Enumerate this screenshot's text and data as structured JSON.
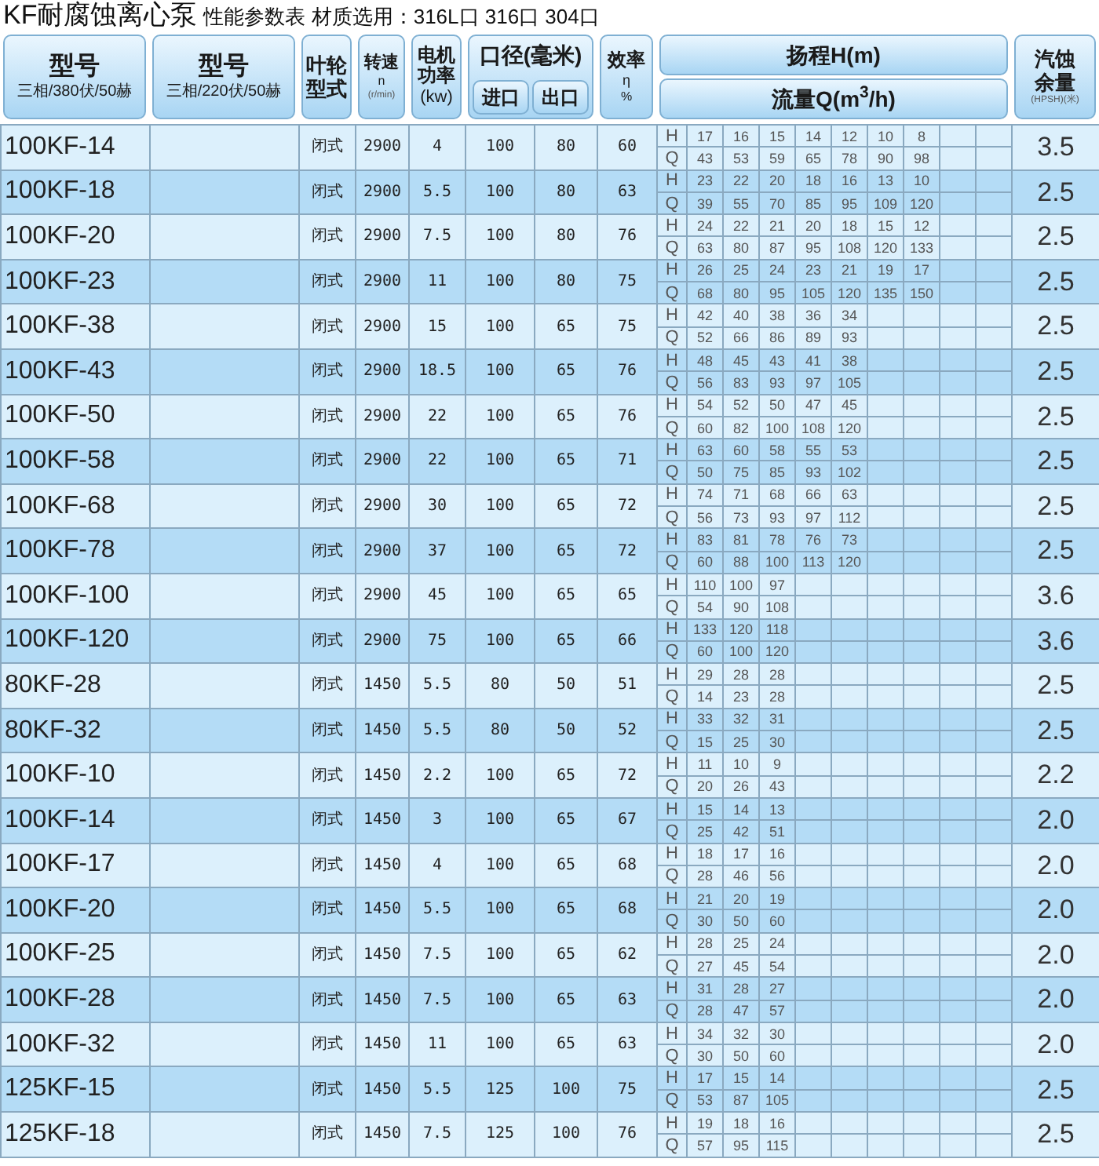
{
  "title": {
    "main": "KF耐腐蚀离心泵",
    "sub": "性能参数表 材质选用：316L口 316口 304口"
  },
  "header": {
    "model_380": {
      "label": "型号",
      "note": "三相/380伏/50赫"
    },
    "model_220": {
      "label": "型号",
      "note": "三相/220伏/50赫"
    },
    "impeller": "叶轮型式",
    "speed": {
      "label": "转速",
      "symbol": "n",
      "unit": "(r/min)"
    },
    "power": {
      "label": "电机功率",
      "unit": "(kw)"
    },
    "bore": {
      "label": "口径(毫米)",
      "inlet": "进口",
      "outlet": "出口"
    },
    "efficiency": {
      "label": "效率",
      "symbol": "η",
      "unit": "%"
    },
    "head": "扬程H(m)",
    "flow": "流量Q(m$^{3}$/h)",
    "npsh": {
      "label": "汽蚀余量",
      "unit": "(HPSH)(米)"
    }
  },
  "rows": [
    {
      "model": "100KF-14",
      "impeller": "闭式",
      "speed": "2900",
      "power": "4",
      "inlet": "100",
      "outlet": "80",
      "efficiency": "60",
      "h_label": "H",
      "h": [
        "17",
        "16",
        "15",
        "14",
        "12",
        "10",
        "8"
      ],
      "q_label": "Q",
      "q": [
        "43",
        "53",
        "59",
        "65",
        "78",
        "90",
        "98"
      ],
      "npsh": "3.5"
    },
    {
      "model": "100KF-18",
      "impeller": "闭式",
      "speed": "2900",
      "power": "5.5",
      "inlet": "100",
      "outlet": "80",
      "efficiency": "63",
      "h_label": "H",
      "h": [
        "23",
        "22",
        "20",
        "18",
        "16",
        "13",
        "10"
      ],
      "q_label": "Q",
      "q": [
        "39",
        "55",
        "70",
        "85",
        "95",
        "109",
        "120"
      ],
      "npsh": "2.5"
    },
    {
      "model": "100KF-20",
      "impeller": "闭式",
      "speed": "2900",
      "power": "7.5",
      "inlet": "100",
      "outlet": "80",
      "efficiency": "76",
      "h_label": "H",
      "h": [
        "24",
        "22",
        "21",
        "20",
        "18",
        "15",
        "12"
      ],
      "q_label": "Q",
      "q": [
        "63",
        "80",
        "87",
        "95",
        "108",
        "120",
        "133"
      ],
      "npsh": "2.5"
    },
    {
      "model": "100KF-23",
      "impeller": "闭式",
      "speed": "2900",
      "power": "11",
      "inlet": "100",
      "outlet": "80",
      "efficiency": "75",
      "h_label": "H",
      "h": [
        "26",
        "25",
        "24",
        "23",
        "21",
        "19",
        "17"
      ],
      "q_label": "Q",
      "q": [
        "68",
        "80",
        "95",
        "105",
        "120",
        "135",
        "150"
      ],
      "npsh": "2.5"
    },
    {
      "model": "100KF-38",
      "impeller": "闭式",
      "speed": "2900",
      "power": "15",
      "inlet": "100",
      "outlet": "65",
      "efficiency": "75",
      "h_label": "H",
      "h": [
        "42",
        "40",
        "38",
        "36",
        "34"
      ],
      "q_label": "Q",
      "q": [
        "52",
        "66",
        "86",
        "89",
        "93"
      ],
      "npsh": "2.5"
    },
    {
      "model": "100KF-43",
      "impeller": "闭式",
      "speed": "2900",
      "power": "18.5",
      "inlet": "100",
      "outlet": "65",
      "efficiency": "76",
      "h_label": "H",
      "h": [
        "48",
        "45",
        "43",
        "41",
        "38"
      ],
      "q_label": "Q",
      "q": [
        "56",
        "83",
        "93",
        "97",
        "105"
      ],
      "npsh": "2.5"
    },
    {
      "model": "100KF-50",
      "impeller": "闭式",
      "speed": "2900",
      "power": "22",
      "inlet": "100",
      "outlet": "65",
      "efficiency": "76",
      "h_label": "H",
      "h": [
        "54",
        "52",
        "50",
        "47",
        "45"
      ],
      "q_label": "Q",
      "q": [
        "60",
        "82",
        "100",
        "108",
        "120"
      ],
      "npsh": "2.5"
    },
    {
      "model": "100KF-58",
      "impeller": "闭式",
      "speed": "2900",
      "power": "22",
      "inlet": "100",
      "outlet": "65",
      "efficiency": "71",
      "h_label": "H",
      "h": [
        "63",
        "60",
        "58",
        "55",
        "53"
      ],
      "q_label": "Q",
      "q": [
        "50",
        "75",
        "85",
        "93",
        "102"
      ],
      "npsh": "2.5"
    },
    {
      "model": "100KF-68",
      "impeller": "闭式",
      "speed": "2900",
      "power": "30",
      "inlet": "100",
      "outlet": "65",
      "efficiency": "72",
      "h_label": "H",
      "h": [
        "74",
        "71",
        "68",
        "66",
        "63"
      ],
      "q_label": "Q",
      "q": [
        "56",
        "73",
        "93",
        "97",
        "112"
      ],
      "npsh": "2.5"
    },
    {
      "model": "100KF-78",
      "impeller": "闭式",
      "speed": "2900",
      "power": "37",
      "inlet": "100",
      "outlet": "65",
      "efficiency": "72",
      "h_label": "H",
      "h": [
        "83",
        "81",
        "78",
        "76",
        "73"
      ],
      "q_label": "Q",
      "q": [
        "60",
        "88",
        "100",
        "113",
        "120"
      ],
      "npsh": "2.5"
    },
    {
      "model": "100KF-100",
      "impeller": "闭式",
      "speed": "2900",
      "power": "45",
      "inlet": "100",
      "outlet": "65",
      "efficiency": "65",
      "h_label": "H",
      "h": [
        "110",
        "100",
        "97"
      ],
      "q_label": "Q",
      "q": [
        "54",
        "90",
        "108"
      ],
      "npsh": "3.6"
    },
    {
      "model": "100KF-120",
      "impeller": "闭式",
      "speed": "2900",
      "power": "75",
      "inlet": "100",
      "outlet": "65",
      "efficiency": "66",
      "h_label": "H",
      "h": [
        "133",
        "120",
        "118"
      ],
      "q_label": "Q",
      "q": [
        "60",
        "100",
        "120"
      ],
      "npsh": "3.6"
    },
    {
      "model": "80KF-28",
      "impeller": "闭式",
      "speed": "1450",
      "power": "5.5",
      "inlet": "80",
      "outlet": "50",
      "efficiency": "51",
      "h_label": "H",
      "h": [
        "29",
        "28",
        "28"
      ],
      "q_label": "Q",
      "q": [
        "14",
        "23",
        "28"
      ],
      "npsh": "2.5"
    },
    {
      "model": "80KF-32",
      "impeller": "闭式",
      "speed": "1450",
      "power": "5.5",
      "inlet": "80",
      "outlet": "50",
      "efficiency": "52",
      "h_label": "H",
      "h": [
        "33",
        "32",
        "31"
      ],
      "q_label": "Q",
      "q": [
        "15",
        "25",
        "30"
      ],
      "npsh": "2.5"
    },
    {
      "model": "100KF-10",
      "impeller": "闭式",
      "speed": "1450",
      "power": "2.2",
      "inlet": "100",
      "outlet": "65",
      "efficiency": "72",
      "h_label": "H",
      "h": [
        "11",
        "10",
        "9"
      ],
      "q_label": "Q",
      "q": [
        "20",
        "26",
        "43"
      ],
      "npsh": "2.2"
    },
    {
      "model": "100KF-14",
      "impeller": "闭式",
      "speed": "1450",
      "power": "3",
      "inlet": "100",
      "outlet": "65",
      "efficiency": "67",
      "h_label": "H",
      "h": [
        "15",
        "14",
        "13"
      ],
      "q_label": "Q",
      "q": [
        "25",
        "42",
        "51"
      ],
      "npsh": "2.0"
    },
    {
      "model": "100KF-17",
      "impeller": "闭式",
      "speed": "1450",
      "power": "4",
      "inlet": "100",
      "outlet": "65",
      "efficiency": "68",
      "h_label": "H",
      "h": [
        "18",
        "17",
        "16"
      ],
      "q_label": "Q",
      "q": [
        "28",
        "46",
        "56"
      ],
      "npsh": "2.0"
    },
    {
      "model": "100KF-20",
      "impeller": "闭式",
      "speed": "1450",
      "power": "5.5",
      "inlet": "100",
      "outlet": "65",
      "efficiency": "68",
      "h_label": "H",
      "h": [
        "21",
        "20",
        "19"
      ],
      "q_label": "Q",
      "q": [
        "30",
        "50",
        "60"
      ],
      "npsh": "2.0"
    },
    {
      "model": "100KF-25",
      "impeller": "闭式",
      "speed": "1450",
      "power": "7.5",
      "inlet": "100",
      "outlet": "65",
      "efficiency": "62",
      "h_label": "H",
      "h": [
        "28",
        "25",
        "24"
      ],
      "q_label": "Q",
      "q": [
        "27",
        "45",
        "54"
      ],
      "npsh": "2.0"
    },
    {
      "model": "100KF-28",
      "impeller": "闭式",
      "speed": "1450",
      "power": "7.5",
      "inlet": "100",
      "outlet": "65",
      "efficiency": "63",
      "h_label": "H",
      "h": [
        "31",
        "28",
        "27"
      ],
      "q_label": "Q",
      "q": [
        "28",
        "47",
        "57"
      ],
      "npsh": "2.0"
    },
    {
      "model": "100KF-32",
      "impeller": "闭式",
      "speed": "1450",
      "power": "11",
      "inlet": "100",
      "outlet": "65",
      "efficiency": "63",
      "h_label": "H",
      "h": [
        "34",
        "32",
        "30"
      ],
      "q_label": "Q",
      "q": [
        "30",
        "50",
        "60"
      ],
      "npsh": "2.0"
    },
    {
      "model": "125KF-15",
      "impeller": "闭式",
      "speed": "1450",
      "power": "5.5",
      "inlet": "125",
      "outlet": "100",
      "efficiency": "75",
      "h_label": "H",
      "h": [
        "17",
        "15",
        "14"
      ],
      "q_label": "Q",
      "q": [
        "53",
        "87",
        "105"
      ],
      "npsh": "2.5"
    },
    {
      "model": "125KF-18",
      "impeller": "闭式",
      "speed": "1450",
      "power": "7.5",
      "inlet": "125",
      "outlet": "100",
      "efficiency": "76",
      "h_label": "H",
      "h": [
        "19",
        "18",
        "16"
      ],
      "q_label": "Q",
      "q": [
        "57",
        "95",
        "115"
      ],
      "npsh": "2.5"
    }
  ]
}
